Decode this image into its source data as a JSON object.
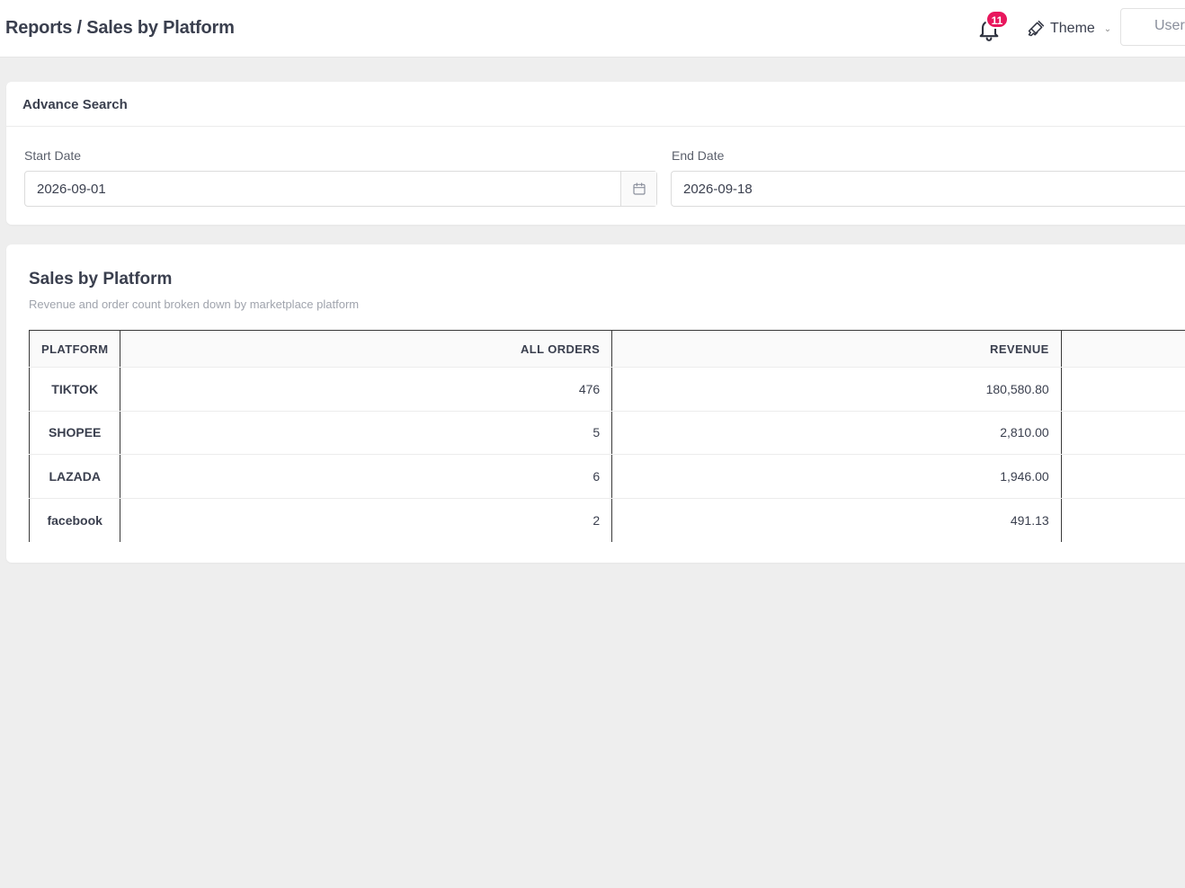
{
  "header": {
    "breadcrumb": "Reports / Sales by Platform",
    "notification_count": "11",
    "theme_label": "Theme",
    "user_label": "User"
  },
  "search": {
    "title": "Advance Search",
    "start_label": "Start Date",
    "start_value": "2026-09-01",
    "end_label": "End Date",
    "end_value": "2026-09-18"
  },
  "report": {
    "title": "Sales by Platform",
    "subtitle": "Revenue and order count broken down by marketplace platform",
    "columns": {
      "platform": "PLATFORM",
      "orders": "ALL ORDERS",
      "revenue": "REVENUE"
    },
    "rows": [
      {
        "platform": "TIKTOK",
        "orders": "476",
        "revenue": "180,580.80"
      },
      {
        "platform": "SHOPEE",
        "orders": "5",
        "revenue": "2,810.00"
      },
      {
        "platform": "LAZADA",
        "orders": "6",
        "revenue": "1,946.00"
      },
      {
        "platform": "facebook",
        "orders": "2",
        "revenue": "491.13"
      }
    ]
  },
  "icons": {
    "bell": "bell-icon",
    "theme": "paintbrush-icon",
    "chevron": "chevron-down-icon",
    "calendar": "calendar-icon"
  },
  "colors": {
    "badge": "#e8175d",
    "background": "#eeeeee",
    "text": "#3a3f4e"
  }
}
